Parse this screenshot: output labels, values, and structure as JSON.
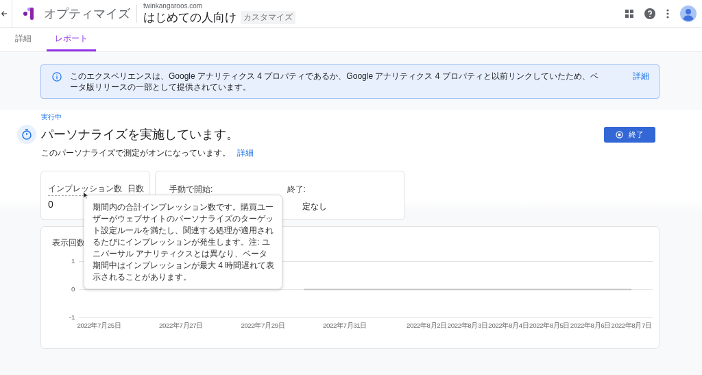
{
  "header": {
    "product": "オプティマイズ",
    "site": "twinkangaroos.com",
    "experience": "はじめての人向け",
    "badge": "カスタマイズ"
  },
  "tabs": [
    {
      "label": "詳細",
      "selected": false
    },
    {
      "label": "レポート",
      "selected": true
    }
  ],
  "banner": {
    "text": "このエクスペリエンスは、Google アナリティクス 4 プロパティであるか、Google アナリティクス 4 プロパティと以前リンクしていたため、ベータ版リリースの一部として提供されています。",
    "link": "詳細"
  },
  "status": {
    "label": "実行中",
    "title": "パーソナライズを実施しています。",
    "description": "このパーソナライズで測定がオンになっています。",
    "link": "詳細",
    "button": "終了"
  },
  "stats": [
    {
      "label": "インプレッション数",
      "value": "0"
    },
    {
      "label": "日数"
    }
  ],
  "schedule": [
    {
      "label": "手動で開始:"
    },
    {
      "label": "終了:",
      "value": "定なし"
    }
  ],
  "tooltip": "期間内の合計インプレッション数です。購買ユーザーがウェブサイトのパーソナライズのターゲット設定ルールを満たし、関連する処理が適用されるたびにインプレッションが発生します。注: ユニバーサル アナリティクスとは異なり、ベータ期間中はインプレッションが最大 4 時間遅れて表示されることがあります。",
  "chart": {
    "title": "表示回数",
    "chart_data": {
      "type": "line",
      "categories": [
        "2022年7月25日",
        null,
        "2022年7月27日",
        null,
        "2022年7月29日",
        null,
        "2022年7月31日",
        null,
        "2022年8月2日",
        "2022年8月3日",
        "2022年8月4日",
        "2022年8月5日",
        "2022年8月6日",
        "2022年8月7日"
      ],
      "series": [
        {
          "color": "#c4c4c4",
          "values": [
            null,
            null,
            null,
            null,
            null,
            0,
            0,
            0,
            0,
            0,
            0,
            0,
            0,
            0
          ]
        }
      ],
      "ylim": [
        -1,
        1
      ],
      "yticks": [
        -1,
        0,
        1
      ]
    }
  }
}
